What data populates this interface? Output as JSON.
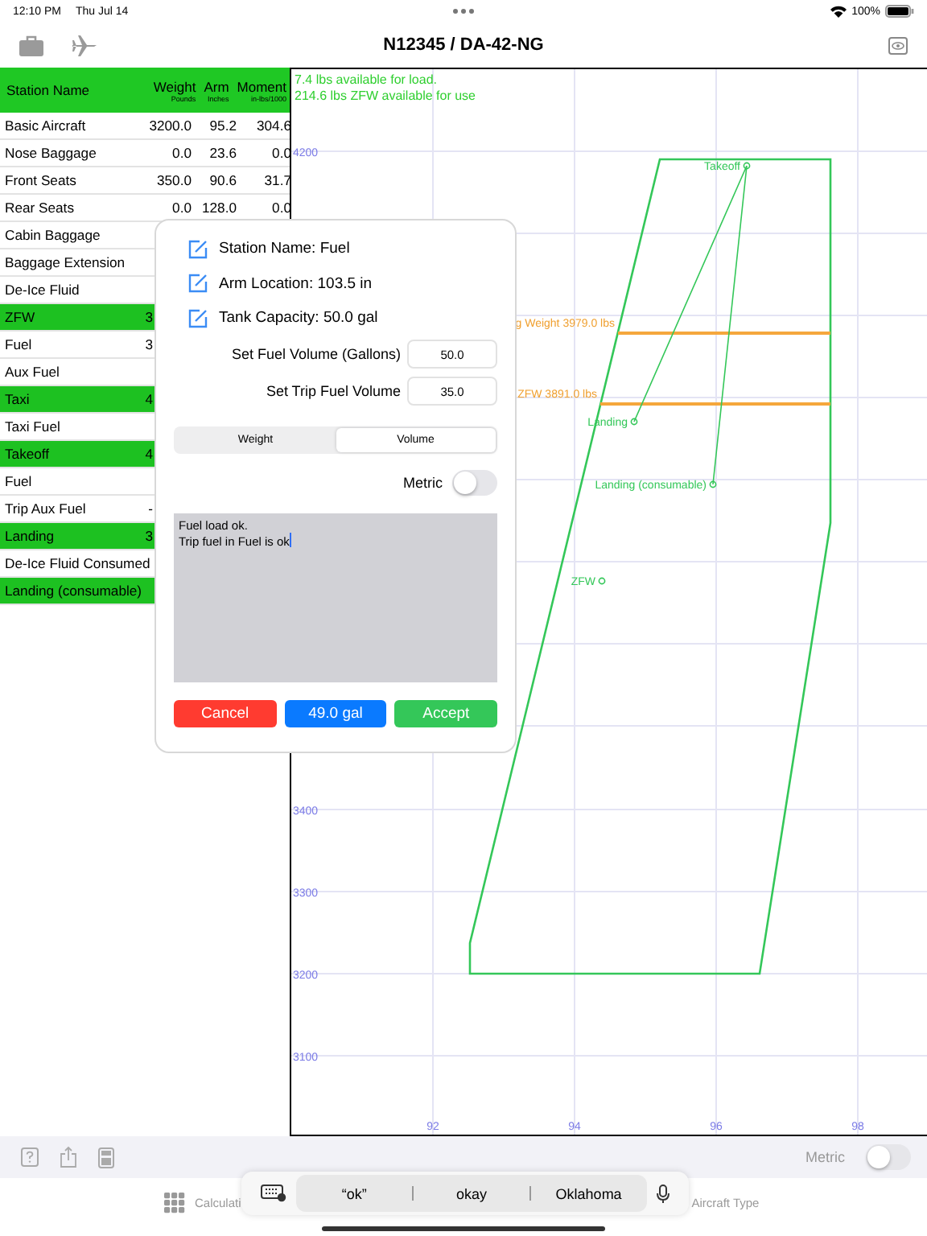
{
  "status_bar": {
    "time": "12:10 PM",
    "date": "Thu Jul 14",
    "battery": "100%"
  },
  "nav": {
    "title": "N12345 / DA-42-NG"
  },
  "table": {
    "columns": [
      {
        "label": "Station Name"
      },
      {
        "label": "Weight",
        "unit": "Pounds"
      },
      {
        "label": "Arm",
        "unit": "Inches"
      },
      {
        "label": "Moment",
        "unit": "in-lbs/1000"
      }
    ],
    "rows": [
      {
        "kind": "station",
        "name": "Basic Aircraft",
        "weight": "3200.0",
        "arm": "95.2",
        "moment": "304.6"
      },
      {
        "kind": "station",
        "name": "Nose Baggage",
        "weight": "0.0",
        "arm": "23.6",
        "moment": "0.0"
      },
      {
        "kind": "station",
        "name": "Front Seats",
        "weight": "350.0",
        "arm": "90.6",
        "moment": "31.7"
      },
      {
        "kind": "station",
        "name": "Rear Seats",
        "weight": "0.0",
        "arm": "128.0",
        "moment": "0.0"
      },
      {
        "kind": "station",
        "name": "Cabin Baggage"
      },
      {
        "kind": "station",
        "name": "Baggage Extension"
      },
      {
        "kind": "station",
        "name": "De-Ice Fluid"
      },
      {
        "kind": "total",
        "name": "ZFW",
        "weight": "3"
      },
      {
        "kind": "station",
        "name": "Fuel",
        "weight": "3"
      },
      {
        "kind": "station",
        "name": "Aux Fuel"
      },
      {
        "kind": "total",
        "name": "Taxi",
        "weight": "4"
      },
      {
        "kind": "station",
        "name": "Taxi Fuel"
      },
      {
        "kind": "total",
        "name": "Takeoff",
        "weight": "4"
      },
      {
        "kind": "station",
        "name": "Fuel"
      },
      {
        "kind": "station",
        "name": "Trip Aux Fuel",
        "weight": "-"
      },
      {
        "kind": "total",
        "name": "Landing",
        "weight": "3"
      },
      {
        "kind": "station",
        "name": "De-Ice Fluid Consumed"
      },
      {
        "kind": "total",
        "name": "Landing (consumable)"
      }
    ]
  },
  "chart": {
    "messages": [
      "7.4 lbs available for load.",
      "214.6 lbs ZFW available for use"
    ],
    "y_labels": [
      "4200",
      "3400",
      "3300",
      "3200",
      "3100"
    ],
    "x_labels": [
      "92",
      "94",
      "96",
      "98"
    ],
    "limits": [
      "g Weight 3979.0 lbs",
      "ZFW 3891.0 lbs"
    ],
    "points": [
      "Takeoff",
      "Landing",
      "Landing (consumable)",
      "ZFW"
    ]
  },
  "popover": {
    "info": [
      "Station Name: Fuel",
      "Arm Location: 103.5 in",
      "Tank Capacity: 50.0 gal"
    ],
    "fields": [
      {
        "label": "Set Fuel Volume (Gallons)",
        "value": "50.0"
      },
      {
        "label": "Set Trip Fuel Volume",
        "value": "35.0"
      }
    ],
    "segments": [
      {
        "label": "Weight",
        "selected": false
      },
      {
        "label": "Volume",
        "selected": true
      }
    ],
    "metric": {
      "label": "Metric",
      "on": false
    },
    "message": "Fuel load ok.\nTrip fuel in Fuel is ok",
    "buttons": [
      {
        "kind": "cancel",
        "label": "Cancel"
      },
      {
        "kind": "info",
        "label": "49.0 gal"
      },
      {
        "kind": "accept",
        "label": "Accept"
      }
    ]
  },
  "toolbar": {
    "metric": {
      "label": "Metric",
      "on": false
    }
  },
  "tab_bar": {
    "items": [
      {
        "label": "Calculati"
      },
      {
        "label": "Aircraft Type"
      }
    ]
  },
  "keyboard_bar": {
    "suggestions": [
      "“ok”",
      "okay",
      "Oklahoma"
    ]
  }
}
